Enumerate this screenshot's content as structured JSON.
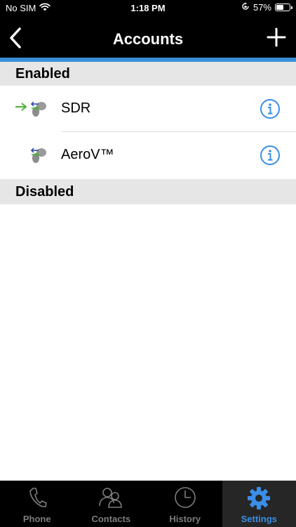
{
  "status_bar": {
    "carrier": "No SIM",
    "time": "1:18 PM",
    "battery_percent": "57%",
    "battery_level": 0.57
  },
  "nav": {
    "title": "Accounts",
    "back_icon": "chevron-left-icon",
    "add_icon": "plus-icon"
  },
  "sections": {
    "enabled": {
      "header": "Enabled",
      "accounts": [
        {
          "name": "SDR",
          "registered": true
        },
        {
          "name": "AeroV™",
          "registered": false
        }
      ]
    },
    "disabled": {
      "header": "Disabled"
    }
  },
  "tabs": [
    {
      "label": "Phone",
      "icon": "phone-icon",
      "active": false
    },
    {
      "label": "Contacts",
      "icon": "contacts-icon",
      "active": false
    },
    {
      "label": "History",
      "icon": "clock-icon",
      "active": false
    },
    {
      "label": "Settings",
      "icon": "gear-icon",
      "active": true
    }
  ],
  "colors": {
    "accent": "#3b8fd8",
    "info_icon": "#3a8ee6",
    "registered_arrow": "#4caf3a",
    "account_arrow": "#2b3ea8"
  }
}
